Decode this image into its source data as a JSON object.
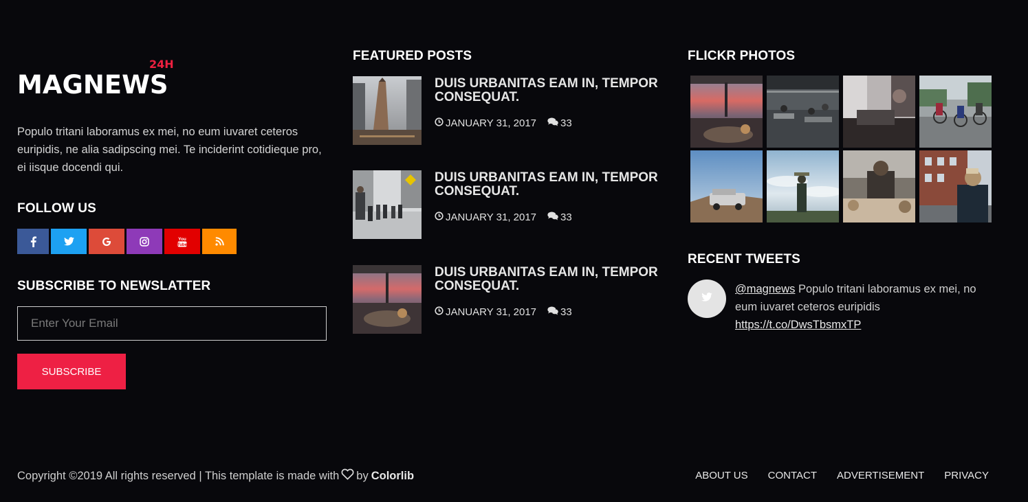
{
  "logo": {
    "text": "MAGNEWS",
    "superscript": "24H"
  },
  "about_text": "Populo tritani laboramus ex mei, no eum iuvaret ceteros euripidis, ne alia sadipscing mei. Te inciderint cotidieque pro, ei iisque docendi qui.",
  "follow": {
    "heading": "FOLLOW US",
    "networks": [
      {
        "icon": "facebook-icon",
        "color": "#3b5998"
      },
      {
        "icon": "twitter-icon",
        "color": "#1da1f2"
      },
      {
        "icon": "google-icon",
        "color": "#dd4b39"
      },
      {
        "icon": "instagram-icon",
        "color": "#8e3ab8"
      },
      {
        "icon": "youtube-icon",
        "color": "#e20000"
      },
      {
        "icon": "rss-icon",
        "color": "#ff8a00"
      }
    ]
  },
  "newsletter": {
    "heading": "SUBSCRIBE TO NEWSLATTER",
    "placeholder": "Enter Your Email",
    "button": "SUBSCRIBE",
    "accent": "#ee2044"
  },
  "featured": {
    "heading": "FEATURED POSTS",
    "posts": [
      {
        "title": "DUIS URBANITAS EAM IN, TEMPOR CONSEQUAT.",
        "date": "JANUARY 31, 2017",
        "comments": "33"
      },
      {
        "title": "DUIS URBANITAS EAM IN, TEMPOR CONSEQUAT.",
        "date": "JANUARY 31, 2017",
        "comments": "33"
      },
      {
        "title": "DUIS URBANITAS EAM IN, TEMPOR CONSEQUAT.",
        "date": "JANUARY 31, 2017",
        "comments": "33"
      }
    ]
  },
  "flickr": {
    "heading": "FLICKR PHOTOS"
  },
  "tweets": {
    "heading": "RECENT TWEETS",
    "handle": "@magnews",
    "text": " Populo tritani laboramus ex mei, no eum iuvaret ceteros euripidis",
    "link": "https://t.co/DwsTbsmxTP"
  },
  "footer": {
    "copyright": "Copyright ©2019 All rights reserved | This template is made with",
    "by": "by",
    "brand": "Colorlib",
    "nav": [
      "ABOUT US",
      "CONTACT",
      "ADVERTISEMENT",
      "PRIVACY"
    ]
  }
}
